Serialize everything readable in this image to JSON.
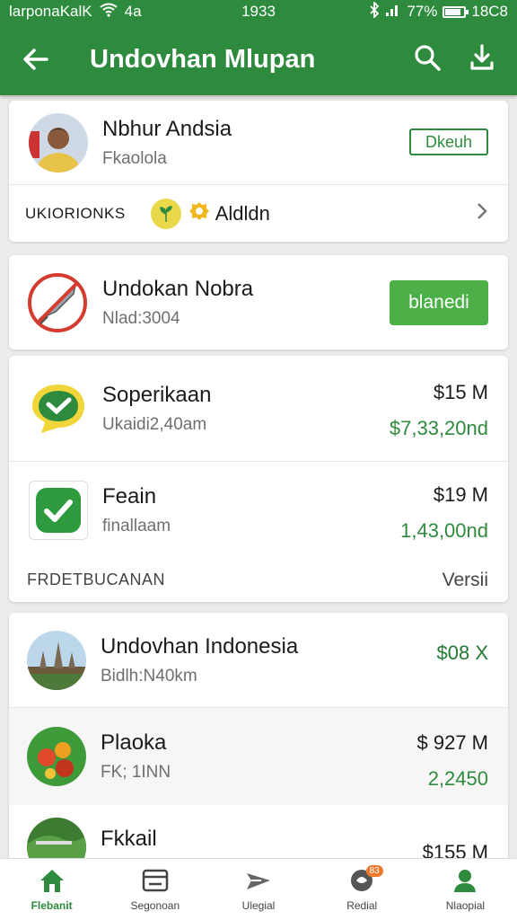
{
  "status_bar": {
    "carrier": "larponaKalK",
    "signal_text": "4a",
    "time": "1933",
    "battery": "77%",
    "battery_level": 0.77,
    "clock_right": "18C8"
  },
  "app_bar": {
    "title": "Undovhan Mlupan",
    "icons": [
      "back-arrow-icon",
      "search-icon",
      "download-icon"
    ]
  },
  "profile": {
    "name": "Nbhur Andsia",
    "subtitle": "Fkaolola",
    "button_label": "Dkeuh"
  },
  "tags_row": {
    "label": "UKIORIONKS",
    "chip_label": "Aldldn"
  },
  "featured": {
    "title": "Undokan Nobra",
    "subtitle": "Nlad:3004",
    "button_label": "blanedi"
  },
  "items": [
    {
      "title": "Soperikaan",
      "subtitle": "Ukaidi2,40am",
      "price": "$15 M",
      "value": "$7,33,20nd"
    },
    {
      "title": "Feain",
      "subtitle": "finallaam",
      "price": "$19 M",
      "value": "1,43,00nd"
    }
  ],
  "section": {
    "label": "FRDETBUCANAN",
    "action": "Versii"
  },
  "list": [
    {
      "title": "Undovhan Indonesia",
      "subtitle": "Bidlh:N40km",
      "price": "",
      "value": "$08 X"
    },
    {
      "title": "Plaoka",
      "subtitle": "FK; 1INN",
      "price": "$ 927 M",
      "value": "2,2450"
    },
    {
      "title": "Fkkail",
      "subtitle": "",
      "price": "$155 M",
      "value": ""
    }
  ],
  "bottom_nav": [
    {
      "label": "Flebanit",
      "icon": "home-icon",
      "active": true
    },
    {
      "label": "Segonoan",
      "icon": "wallet-icon",
      "active": false
    },
    {
      "label": "Ulegial",
      "icon": "send-icon",
      "active": false
    },
    {
      "label": "Redial",
      "icon": "notification-icon",
      "active": false,
      "badge": "83"
    },
    {
      "label": "Nlaopial",
      "icon": "profile-icon",
      "active": false
    }
  ],
  "colors": {
    "primary": "#2e8b3e",
    "button_green": "#4caf47",
    "value_green": "#2e8b3e",
    "badge_orange": "#f07a2c"
  }
}
